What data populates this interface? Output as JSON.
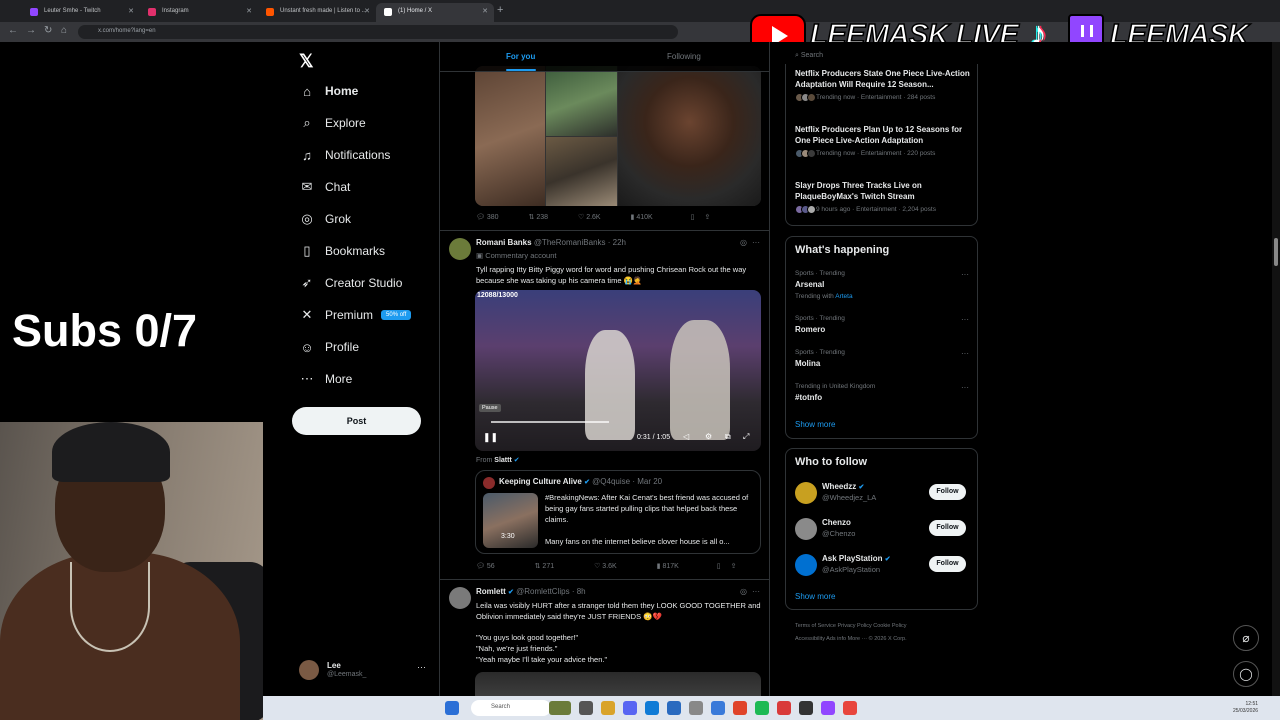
{
  "browser": {
    "tabs": [
      {
        "title": "Leuter Smhe - Twitch",
        "color": "#9146ff"
      },
      {
        "title": "Instagram",
        "color": "#e1306c"
      },
      {
        "title": "Unstant fresh made | Listen to ...",
        "color": "#ff5500"
      },
      {
        "title": "(1) Home / X",
        "color": "#ffffff"
      }
    ],
    "url": "x.com/home?lang=en",
    "new_tab": "+"
  },
  "overlay": {
    "youtube_label": "LEEMASK LIVE",
    "twitch_label": "LEEMASK_",
    "colors": {
      "youtube": "#ff0000",
      "twitch": "#9146ff",
      "tiktok": "#25f4ee"
    }
  },
  "stream": {
    "subs_text": "Subs 0/7"
  },
  "x": {
    "nav": [
      {
        "label": "Home",
        "icon": "home-icon",
        "glyph": "⌂"
      },
      {
        "label": "Explore",
        "icon": "search-icon",
        "glyph": "⌕"
      },
      {
        "label": "Notifications",
        "icon": "bell-icon",
        "glyph": "🔔"
      },
      {
        "label": "Chat",
        "icon": "mail-icon",
        "glyph": "✉"
      },
      {
        "label": "Grok",
        "icon": "grok-icon",
        "glyph": "◎"
      },
      {
        "label": "Bookmarks",
        "icon": "bookmark-icon",
        "glyph": "❏"
      },
      {
        "label": "Creator Studio",
        "icon": "rocket-icon",
        "glyph": "➶"
      },
      {
        "label": "Premium",
        "icon": "x-premium-icon",
        "glyph": "𝕏",
        "badge": "50% off"
      },
      {
        "label": "Profile",
        "icon": "profile-icon",
        "glyph": "☺"
      },
      {
        "label": "More",
        "icon": "more-icon",
        "glyph": "⋯"
      }
    ],
    "post_button": "Post",
    "account": {
      "name": "Lee",
      "handle": "@Leemask_",
      "more": "···"
    },
    "tabs": {
      "for_you": "For you",
      "following": "Following"
    },
    "post1_actions": {
      "replies": "380",
      "reposts": "238",
      "likes": "2.6K",
      "views": "410K"
    },
    "post2": {
      "name": "Romani Banks",
      "handle": "@TheRomaniBanks · 22h",
      "label": "Commentary account",
      "text": "Tyll rapping Itty Bitty Piggy word for word and pushing Chrisean Rock out the way because she was taking up his camera time 😭🤦",
      "video_counter": "12088/13000",
      "tooltip": "Pause",
      "time": "0:31 / 1:05",
      "from_prefix": "From",
      "from_name": "Slattt",
      "quote": {
        "name": "Keeping Culture Alive",
        "handle": "@Q4quise · Mar 20",
        "text": "#BreakingNews: After Kai Cenat's best friend was accused of being gay fans started pulling clips that helped back these claims.",
        "text2": "Many fans on the internet believe clover house is all o...",
        "duration": "3:30"
      },
      "actions": {
        "replies": "56",
        "reposts": "271",
        "likes": "3.6K",
        "views": "817K"
      }
    },
    "post3": {
      "name": "Romlett",
      "handle": "@RomlettClips · 8h",
      "text1": "Leila was visibly HURT after a stranger told them they LOOK GOOD TOGETHER and Oblivion immediately said they're JUST FRIENDS 😳💔",
      "text2": "\"You guys look good together!\"",
      "text3": "\"Nah, we're just friends.\"",
      "text4": "\"Yeah maybe I'll take your advice then.\""
    },
    "search_placeholder": "Search",
    "news": [
      {
        "title": "Netflix Producers State One Piece Live-Action Adaptation Will Require 12 Season...",
        "meta": "Trending now · Entertainment · 284 posts"
      },
      {
        "title": "Netflix Producers Plan Up to 12 Seasons for One Piece Live-Action Adaptation",
        "meta": "Trending now · Entertainment · 220 posts"
      },
      {
        "title": "Slayr Drops Three Tracks Live on PlaqueBoyMax's Twitch Stream",
        "meta": "9 hours ago · Entertainment · 2,204 posts"
      }
    ],
    "whats_happening": {
      "title": "What's happening",
      "items": [
        {
          "context": "Sports · Trending",
          "topic": "Arsenal",
          "extra_prefix": "Trending with",
          "extra_link": "Arteta"
        },
        {
          "context": "Sports · Trending",
          "topic": "Romero"
        },
        {
          "context": "Sports · Trending",
          "topic": "Molina"
        },
        {
          "context": "Trending in United Kingdom",
          "topic": "#totnfo"
        }
      ],
      "show_more": "Show more"
    },
    "who_to_follow": {
      "title": "Who to follow",
      "items": [
        {
          "name": "Wheedzz",
          "handle": "@Wheedjez_LA",
          "button": "Follow"
        },
        {
          "name": "Chenzo",
          "handle": "@Chenzo",
          "button": "Follow"
        },
        {
          "name": "Ask PlayStation",
          "handle": "@AskPlayStation",
          "button": "Follow"
        }
      ],
      "show_more": "Show more"
    },
    "footer": {
      "line1": "Terms of Service    Privacy Policy    Cookie Policy",
      "line2": "Accessibility    Ads info    More ···    © 2026 X Corp."
    }
  },
  "taskbar": {
    "search_placeholder": "Search",
    "clock_time": "12:51",
    "clock_date": "25/03/2026"
  }
}
